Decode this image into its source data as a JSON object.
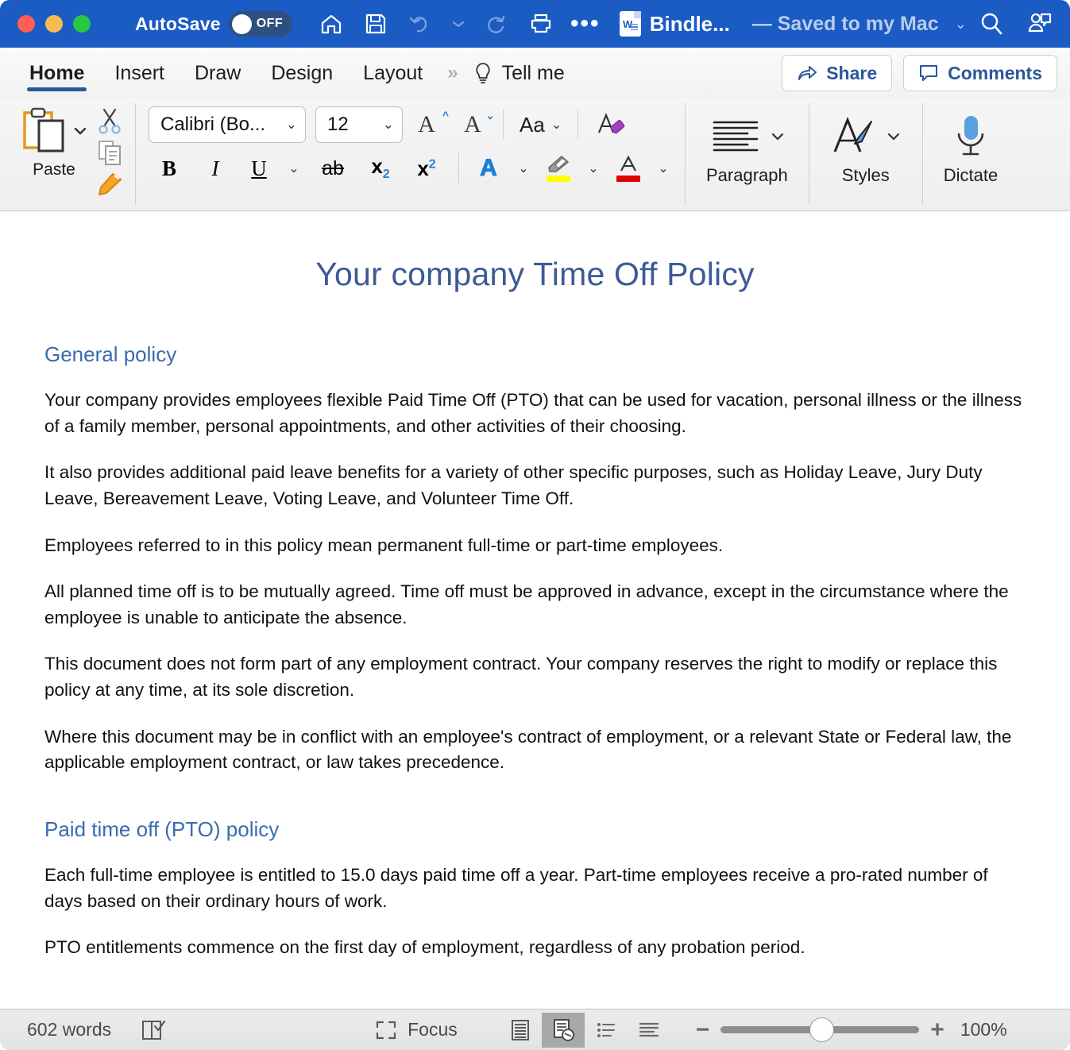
{
  "titlebar": {
    "autosave_label": "AutoSave",
    "autosave_state": "OFF",
    "doc_title": "Bindle...",
    "saved_status": "— Saved to my Mac",
    "icons": [
      "home-icon",
      "save-icon",
      "undo-icon",
      "redo-icon",
      "print-icon",
      "more-icon",
      "search-icon",
      "account-icon"
    ],
    "accent_color": "#1a5bc4"
  },
  "ribbon": {
    "tabs": [
      {
        "label": "Home",
        "active": true
      },
      {
        "label": "Insert",
        "active": false
      },
      {
        "label": "Draw",
        "active": false
      },
      {
        "label": "Design",
        "active": false
      },
      {
        "label": "Layout",
        "active": false
      }
    ],
    "overflow_chevron": "»",
    "tell_me": "Tell me",
    "share_label": "Share",
    "comments_label": "Comments",
    "active_tab_underline_color": "#2b579a",
    "clipboard": {
      "paste_label": "Paste",
      "cut_label": "cut-icon",
      "copy_label": "copy-icon",
      "format_painter_label": "format-painter-icon"
    },
    "font": {
      "font_name": "Calibri (Bo...",
      "font_size": "12",
      "grow_font": "A",
      "shrink_font": "A",
      "change_case": "Aa",
      "clear_formatting": "clear-formatting-icon",
      "bold": "B",
      "italic": "I",
      "underline": "U",
      "strikethrough": "ab",
      "subscript": "x",
      "superscript": "x",
      "text_effects": "A",
      "highlight_color": "#ffff00",
      "font_color": "#e00000"
    },
    "groups": [
      {
        "label": "Paragraph",
        "icon": "paragraph-icon"
      },
      {
        "label": "Styles",
        "icon": "styles-icon"
      },
      {
        "label": "Dictate",
        "icon": "microphone-icon"
      }
    ]
  },
  "document": {
    "title": "Your company Time Off Policy",
    "title_color": "#3c5a96",
    "heading_color": "#3a6bb0",
    "sections": [
      {
        "heading": "General policy",
        "paragraphs": [
          "Your company provides employees flexible Paid Time Off (PTO) that can be used for vacation, personal illness or the illness of a family member, personal appointments, and other activities of their choosing.",
          "It also provides additional paid leave benefits for a variety of other specific purposes, such as Holiday Leave, Jury Duty Leave, Bereavement Leave, Voting Leave, and Volunteer Time Off.",
          "Employees referred to in this policy mean permanent full-time or part-time employees.",
          "All planned time off is to be mutually agreed. Time off must be approved in advance, except in the circumstance where the employee is unable to anticipate the absence.",
          "This document does not form part of any employment contract. Your company reserves the right to modify or replace this policy at any time, at its sole discretion.",
          "Where this document may be in conflict with an employee's contract of employment, or a relevant State or Federal law, the applicable employment contract, or law takes precedence."
        ]
      },
      {
        "heading": "Paid time off (PTO) policy",
        "paragraphs": [
          "Each full-time employee is entitled to 15.0 days paid time off a year. Part-time employees receive a pro-rated number of days based on their ordinary hours of work.",
          "PTO entitlements commence on the first day of employment, regardless of any probation period."
        ]
      }
    ]
  },
  "statusbar": {
    "word_count": "602 words",
    "proofing_icon": "spellcheck-icon",
    "focus_label": "Focus",
    "views": [
      {
        "name": "print-layout-view",
        "active": false
      },
      {
        "name": "web-layout-view",
        "active": true
      },
      {
        "name": "outline-view",
        "active": false
      },
      {
        "name": "draft-view",
        "active": false
      }
    ],
    "zoom_minus": "−",
    "zoom_plus": "+",
    "zoom_level": "100%"
  }
}
